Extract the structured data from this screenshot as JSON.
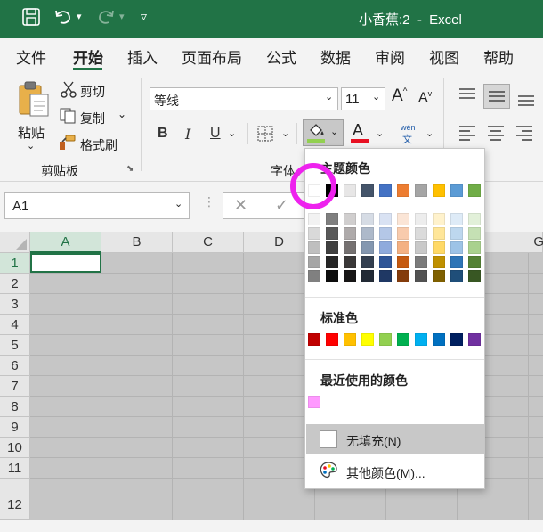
{
  "window": {
    "title": "小香蕉:2  -  Excel"
  },
  "tabs": [
    {
      "label": "文件"
    },
    {
      "label": "开始"
    },
    {
      "label": "插入"
    },
    {
      "label": "页面布局"
    },
    {
      "label": "公式"
    },
    {
      "label": "数据"
    },
    {
      "label": "审阅"
    },
    {
      "label": "视图"
    },
    {
      "label": "帮助"
    }
  ],
  "active_tab": "开始",
  "ribbon": {
    "paste_label": "粘贴",
    "cut_label": "剪切",
    "copy_label": "复制",
    "format_painter_label": "格式刷",
    "clipboard_group": "剪贴板",
    "font_group": "字体",
    "font_name": "等线",
    "font_size": "11",
    "bold": "B",
    "italic": "I",
    "underline": "U",
    "font_color_letter": "A",
    "grow_font": "A",
    "shrink_font": "A",
    "phonetic_top": "wén",
    "phonetic_bottom": "文",
    "fill_color_accent": "#92d050",
    "font_color_accent": "#e81123"
  },
  "name_box": {
    "value": "A1"
  },
  "grid": {
    "columns": [
      "A",
      "B",
      "C",
      "D",
      "G"
    ],
    "rows": [
      "1",
      "2",
      "3",
      "4",
      "5",
      "6",
      "7",
      "8",
      "9",
      "10",
      "11",
      "12"
    ]
  },
  "fill_dropdown": {
    "theme_heading": "主题颜色",
    "theme_colors": [
      [
        "#ffffff",
        "#f2f2f2",
        "#d9d9d9",
        "#bfbfbf",
        "#a6a6a6",
        "#808080"
      ],
      [
        "#000000",
        "#7f7f7f",
        "#595959",
        "#404040",
        "#262626",
        "#0d0d0d"
      ],
      [
        "#e7e6e6",
        "#d0cece",
        "#aeaaaa",
        "#757171",
        "#3a3838",
        "#171616"
      ],
      [
        "#44546a",
        "#d6dce5",
        "#adb9ca",
        "#8497b0",
        "#333f50",
        "#222a35"
      ],
      [
        "#4472c4",
        "#d9e2f3",
        "#b4c7e7",
        "#8faadc",
        "#2f5597",
        "#1f3864"
      ],
      [
        "#ed7d31",
        "#fbe5d6",
        "#f8cbad",
        "#f4b183",
        "#c55a11",
        "#843c0c"
      ],
      [
        "#a5a5a5",
        "#ededed",
        "#dbdbdb",
        "#c9c9c9",
        "#7b7b7b",
        "#525252"
      ],
      [
        "#ffc000",
        "#fff2cc",
        "#ffe699",
        "#ffd966",
        "#bf9000",
        "#7f6000"
      ],
      [
        "#5b9bd5",
        "#deebf7",
        "#bdd7ee",
        "#9dc3e6",
        "#2e75b6",
        "#1f4e79"
      ],
      [
        "#70ad47",
        "#e2f0d9",
        "#c5e0b4",
        "#a9d18e",
        "#548235",
        "#385723"
      ]
    ],
    "standard_heading": "标准色",
    "standard_colors": [
      "#c00000",
      "#ff0000",
      "#ffc000",
      "#ffff00",
      "#92d050",
      "#00b050",
      "#00b0f0",
      "#0070c0",
      "#002060",
      "#7030a0"
    ],
    "recent_heading": "最近使用的颜色",
    "recent_colors": [
      "#ff99ff"
    ],
    "no_fill_label": "无填充(N)",
    "more_colors_label": "其他颜色(M)..."
  }
}
